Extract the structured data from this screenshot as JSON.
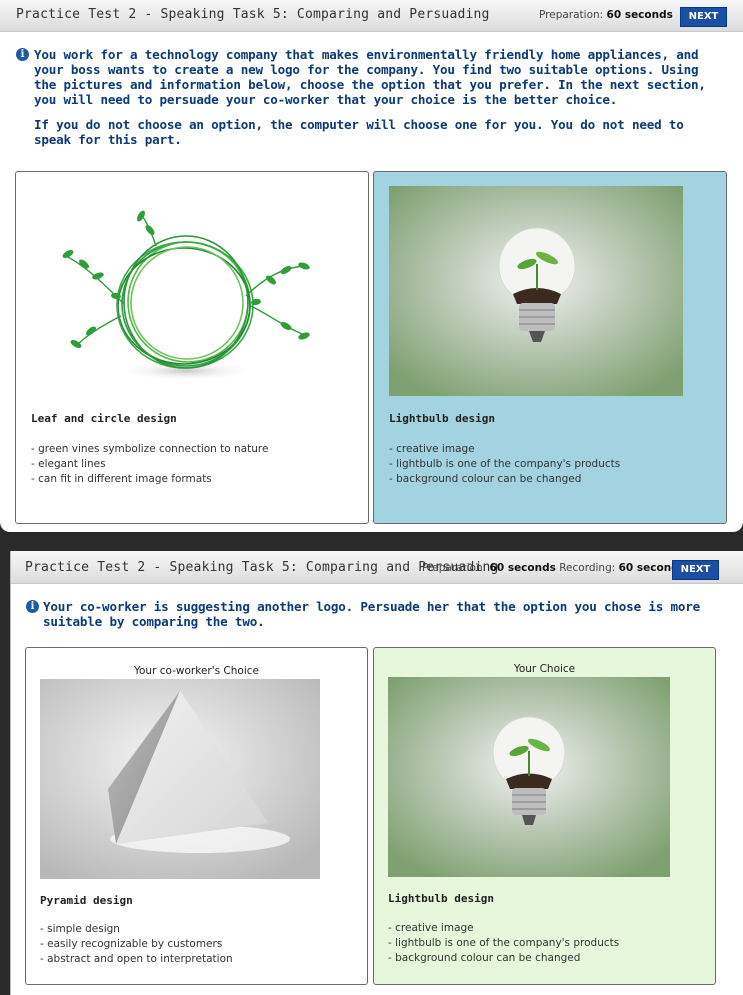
{
  "screen1": {
    "title": "Practice Test 2 - Speaking Task 5: Comparing and Persuading",
    "prep_label": "Preparation:",
    "prep_value": "60 seconds",
    "next_label": "NEXT",
    "instruction_1": "You work for a technology company that makes environmentally friendly home appliances, and your boss wants to create a new logo for the company. You find two suitable options. Using the pictures and information below, choose the option that you prefer. In the next section, you will need to persuade your co-worker that your choice is the better choice.",
    "instruction_2": "If you do not choose an option, the computer will choose one for you. You do not need to speak for this part.",
    "options": [
      {
        "title": "Leaf and circle design",
        "bullets": [
          "- green vines symbolize connection to nature",
          "- elegant lines",
          "- can fit in different image formats"
        ]
      },
      {
        "title": "Lightbulb design",
        "bullets": [
          "- creative image",
          "- lightbulb is one of the company's products",
          "- background colour can be changed"
        ]
      }
    ]
  },
  "screen2": {
    "title": "Practice Test 2 - Speaking Task 5: Comparing and Persuading",
    "prep_label": "Preparation:",
    "prep_value": "60 seconds",
    "rec_label": "Recording:",
    "rec_value": "60 seconds",
    "next_label": "NEXT",
    "instruction": "Your co-worker is suggesting another logo. Persuade her that the option you chose is more suitable by comparing the two.",
    "coworker": {
      "label": "Your co-worker's Choice",
      "title": "Pyramid design",
      "bullets": [
        "- simple design",
        "- easily recognizable by customers",
        "- abstract and open to interpretation"
      ]
    },
    "yours": {
      "label": "Your Choice",
      "title": "Lightbulb design",
      "bullets": [
        "- creative image",
        "- lightbulb is one of the company's products",
        "- background colour can be changed"
      ]
    }
  },
  "colors": {
    "accent_blue": "#1a4fa3",
    "instruction_text": "#0d3a78",
    "selected_card_bg": "#a3d2e1",
    "your_choice_bg": "#e6f7dc"
  }
}
